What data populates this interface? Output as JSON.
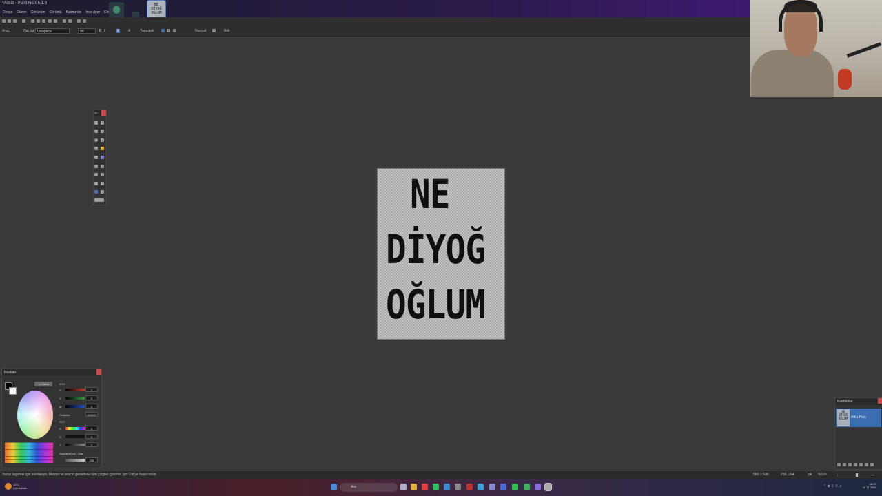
{
  "window": {
    "title": "*Adsız - Paint.NET 5.1.9"
  },
  "menus": [
    "Dosya",
    "Düzen",
    "Görünüm",
    "Görüntü",
    "Katmanlar",
    "İnce Ayar",
    "Efektler"
  ],
  "toolbar": {
    "tool_label": "Araç:",
    "font_label": "Yazı tipi:",
    "font_value": "Unispace",
    "size_value": "90",
    "smoothing_label": "Yumuşak",
    "blend_label": "Normal",
    "finish_label": "Bitir"
  },
  "tools_window": {
    "title": "Ar..."
  },
  "canvas": {
    "lines": [
      "NE",
      "DİYOĞ",
      "OĞLUM"
    ]
  },
  "colors_window": {
    "title": "Renkler",
    "less_button": "<< Daha",
    "rgb_label": "KYM",
    "hex_label": "Onaltılık:",
    "hex_value": "000000",
    "hsv_label": "RGT",
    "alpha_label": "Saydamsızlık - Alfa",
    "alpha_value": "255",
    "channels": [
      {
        "label": "K",
        "value": "0",
        "color": "#c0392b"
      },
      {
        "label": "Y",
        "value": "0",
        "color": "#2ea043"
      },
      {
        "label": "M",
        "value": "0",
        "color": "#2450c8"
      },
      {
        "label": "R",
        "value": "0",
        "color": "#d050c0"
      },
      {
        "label": "D",
        "value": "0",
        "color": "#111111"
      },
      {
        "label": "T",
        "value": "0",
        "color": "#888888"
      }
    ]
  },
  "layers_window": {
    "title": "Katmanlar",
    "layer_name": "Arka Plan"
  },
  "status": {
    "hint": "Yazıyı taşımak için sürükleyin. Metnin ve aracın genelinde tüm çizgiler görünür için Ctrl'ye basılı tutun.",
    "image_size": "500 × 500",
    "cursor_pos": "259, 264",
    "unit": "pk",
    "zoom": "%100"
  },
  "taskbar": {
    "weather_temp": "12°C",
    "weather_desc": "Çok bulutlu",
    "search_placeholder": "Ara",
    "time": "16:29",
    "date": "14.11.2025"
  }
}
